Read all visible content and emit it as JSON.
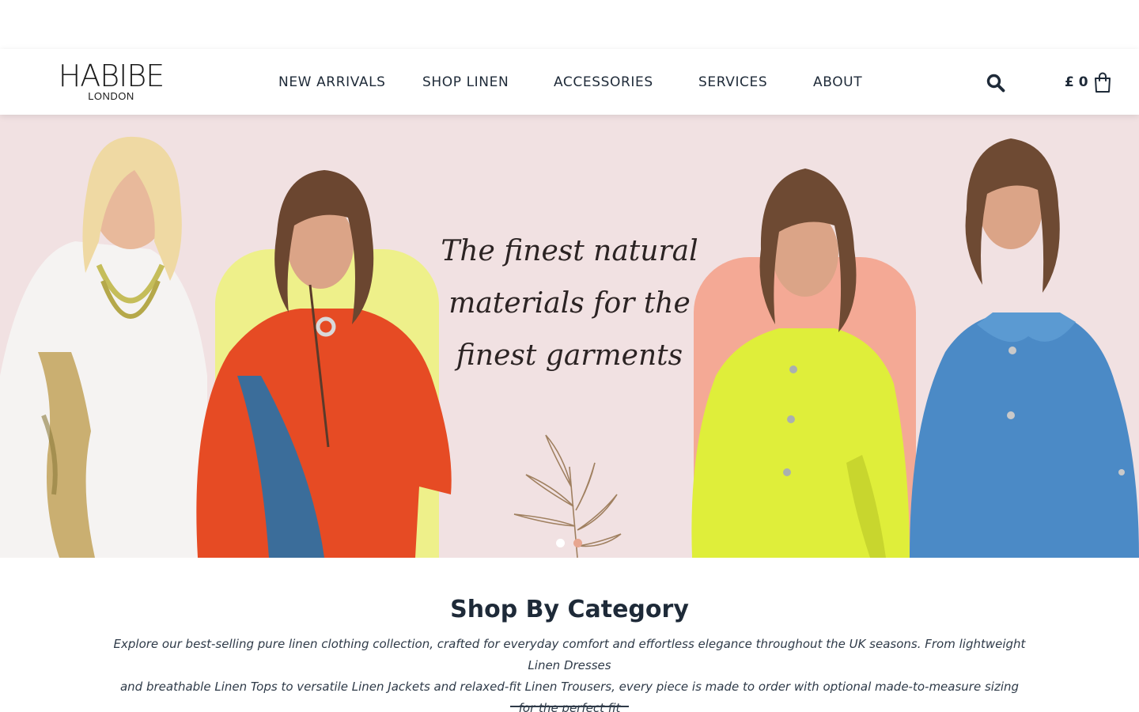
{
  "brand": {
    "name": "HABIBE",
    "sub": "LONDON"
  },
  "nav": {
    "items": [
      {
        "label": "NEW ARRIVALS"
      },
      {
        "label": "SHOP LINEN"
      },
      {
        "label": "ACCESSORIES"
      },
      {
        "label": "SERVICES"
      },
      {
        "label": "ABOUT"
      }
    ]
  },
  "header": {
    "search_icon": "search-icon",
    "cart_amount": "£ 0",
    "cart_icon": "shopping-bag-icon"
  },
  "hero": {
    "headline_lines": [
      "The finest natural",
      "materials for the",
      "finest garments"
    ],
    "slides_total": 2,
    "active_slide": 1,
    "colors": {
      "background": "#f1e1e2",
      "accent_yellow": "#eef08a",
      "accent_peach": "#f4a995"
    }
  },
  "category": {
    "title": "Shop By Category",
    "description_line1": "Explore our best-selling pure linen clothing collection, crafted for everyday comfort and effortless elegance throughout the UK seasons. From lightweight Linen Dresses",
    "description_line2": "and breathable Linen Tops to versatile Linen Jackets and relaxed-fit Linen Trousers, every piece is made to order with optional made-to-measure sizing for the perfect fit"
  }
}
